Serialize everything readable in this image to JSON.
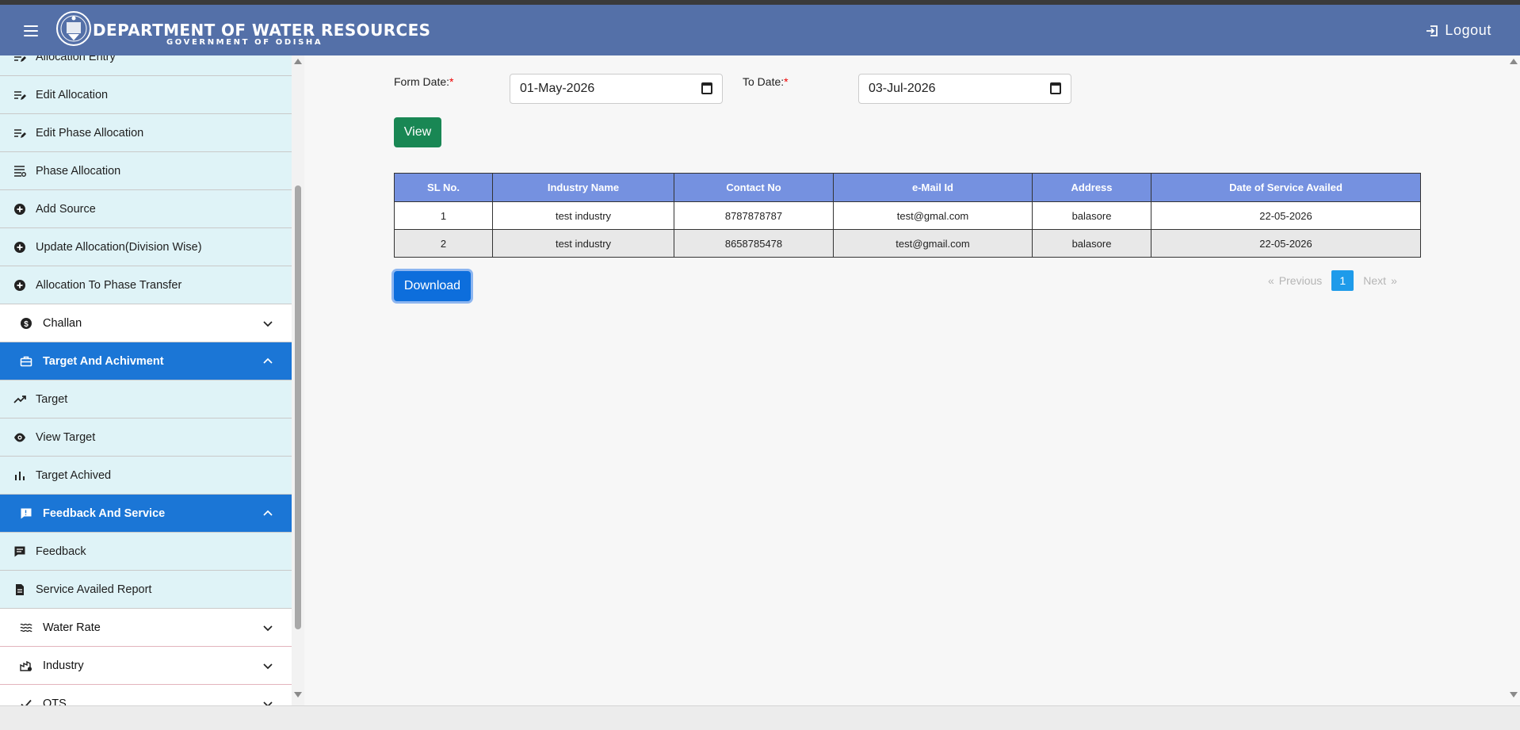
{
  "header": {
    "title": "DEPARTMENT OF WATER RESOURCES",
    "subtitle": "GOVERNMENT OF ODISHA",
    "logout_label": "Logout",
    "bg_color": "#5470a8"
  },
  "sidebar": {
    "items": [
      {
        "label": "Allocation Entry",
        "type": "sub",
        "icon": "edit-list-icon"
      },
      {
        "label": "Edit Allocation",
        "type": "sub",
        "icon": "edit-list-icon"
      },
      {
        "label": "Edit Phase Allocation",
        "type": "sub",
        "icon": "edit-list-icon"
      },
      {
        "label": "Phase Allocation",
        "type": "sub",
        "icon": "list-settings-icon"
      },
      {
        "label": "Add Source",
        "type": "sub",
        "icon": "add-circle-icon"
      },
      {
        "label": "Update Allocation(Division Wise)",
        "type": "sub",
        "icon": "add-circle-icon"
      },
      {
        "label": "Allocation To Phase Transfer",
        "type": "sub",
        "icon": "add-circle-icon"
      },
      {
        "label": "Challan",
        "type": "group",
        "icon": "dollar-circle-icon",
        "expanded": false
      },
      {
        "label": "Target And Achivment",
        "type": "active-group",
        "icon": "briefcase-icon",
        "expanded": true
      },
      {
        "label": "Target",
        "type": "sub",
        "icon": "trending-up-icon"
      },
      {
        "label": "View Target",
        "type": "sub",
        "icon": "eye-icon"
      },
      {
        "label": "Target Achived",
        "type": "sub",
        "icon": "bar-chart-icon"
      },
      {
        "label": "Feedback And Service",
        "type": "active-group",
        "icon": "feedback-icon",
        "expanded": true
      },
      {
        "label": "Feedback",
        "type": "sub",
        "icon": "comment-icon"
      },
      {
        "label": "Service Availed Report",
        "type": "sub",
        "icon": "document-icon"
      },
      {
        "label": "Water Rate",
        "type": "group",
        "icon": "waves-icon",
        "expanded": false
      },
      {
        "label": "Industry",
        "type": "group",
        "icon": "industry-icon",
        "expanded": false
      },
      {
        "label": "OTS",
        "type": "group",
        "icon": "check-icon",
        "expanded": false
      }
    ]
  },
  "filters": {
    "from_label": "Form Date:",
    "from_value": "01-May-2026",
    "to_label": "To Date:",
    "to_value": "03-Jul-2026",
    "required_mark": "*",
    "view_label": "View"
  },
  "table": {
    "headers": [
      "SL No.",
      "Industry Name",
      "Contact No",
      "e-Mail Id",
      "Address",
      "Date of Service Availed"
    ],
    "rows": [
      [
        "1",
        "test industry",
        "8787878787",
        "test@gmal.com",
        "balasore",
        "22-05-2026"
      ],
      [
        "2",
        "test industry",
        "8658785478",
        "test@gmail.com",
        "balasore",
        "22-05-2026"
      ]
    ]
  },
  "actions": {
    "download_label": "Download"
  },
  "pagination": {
    "prev_arrow": "«",
    "prev_label": "Previous",
    "current_page": "1",
    "next_label": "Next",
    "next_arrow": "»"
  },
  "colors": {
    "header_th": "#7591e0",
    "view_btn": "#198754",
    "download_btn": "#0d6edc",
    "active_menu": "#1b76d6",
    "submenu_bg": "#dff3f7"
  }
}
